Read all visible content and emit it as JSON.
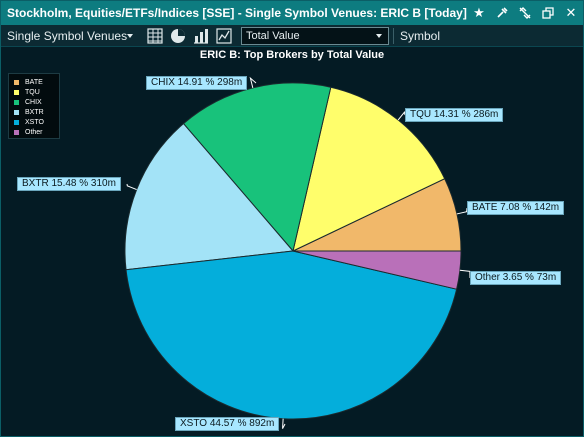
{
  "window": {
    "title": "Stockholm, Equities/ETFs/Indices [SSE] - Single Symbol Venues: ERIC B [Today]"
  },
  "toolbar": {
    "view_dropdown_label": "Single Symbol Venues",
    "metric_select_value": "Total Value",
    "symbol_label": "Symbol"
  },
  "colors": {
    "BATE": "#f1b86a",
    "TQU": "#fffe6b",
    "CHIX": "#18c27b",
    "BXTR": "#a3e3f7",
    "XSTO": "#04aedb",
    "Other": "#b970b9",
    "titlebar": "#0d7c80",
    "background": "#041b24"
  },
  "chart_data": {
    "type": "pie",
    "title": "ERIC B: Top Brokers by Total Value",
    "legend_position": "top-left",
    "slices": [
      {
        "name": "BATE",
        "percent": 7.08,
        "value": "142m",
        "label": "BATE 7.08 % 142m"
      },
      {
        "name": "TQU",
        "percent": 14.31,
        "value": "286m",
        "label": "TQU 14.31 % 286m"
      },
      {
        "name": "CHIX",
        "percent": 14.91,
        "value": "298m",
        "label": "CHIX 14.91 % 298m"
      },
      {
        "name": "BXTR",
        "percent": 15.48,
        "value": "310m",
        "label": "BXTR 15.48 % 310m"
      },
      {
        "name": "XSTO",
        "percent": 44.57,
        "value": "892m",
        "label": "XSTO 44.57 % 892m"
      },
      {
        "name": "Other",
        "percent": 3.65,
        "value": "73m",
        "label": "Other 3.65 % 73m"
      }
    ]
  }
}
